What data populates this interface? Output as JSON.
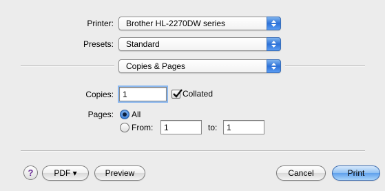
{
  "printer": {
    "label": "Printer:",
    "value": "Brother HL-2270DW series"
  },
  "presets": {
    "label": "Presets:",
    "value": "Standard"
  },
  "panel_popup": {
    "value": "Copies & Pages"
  },
  "copies": {
    "label": "Copies:",
    "value": "1",
    "collated_label": "Collated",
    "collated_checked": true
  },
  "pages": {
    "label": "Pages:",
    "all_label": "All",
    "from_label": "From:",
    "from_value": "1",
    "to_label": "to:",
    "to_value": "1",
    "selected": "all"
  },
  "footer": {
    "help_label": "?",
    "pdf_label": "PDF ▾",
    "preview_label": "Preview",
    "cancel_label": "Cancel",
    "print_label": "Print"
  },
  "colors": {
    "background": "#ececec",
    "accent": "#2e72d8"
  }
}
